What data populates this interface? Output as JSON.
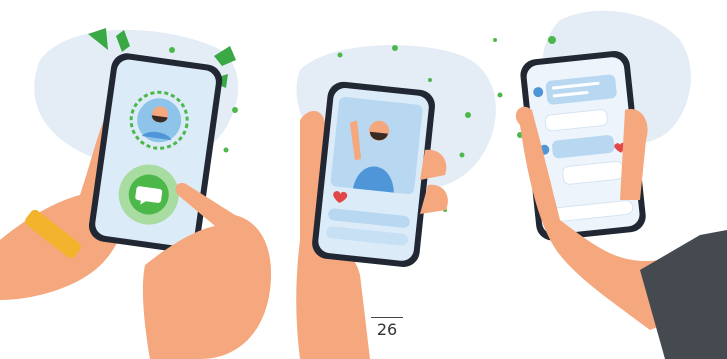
{
  "page": {
    "number": "26"
  },
  "colors": {
    "skin": "#f5a77e",
    "skin_shadow": "#e88e62",
    "blob": "#e4ecf6",
    "phone_frame": "#222833",
    "screen_bg": "#dcebf8",
    "green": "#4db84a",
    "light_green": "#a8dca0",
    "bubble_blue": "#b8d8f2",
    "heart": "#e24747",
    "watch": "#f4b32c",
    "sleeve": "#454a50",
    "avatar_shirt": "#4f96d8",
    "avatar_beard": "#3b2a22"
  },
  "icons": {
    "phone_left_chat": "chat-bubble-icon",
    "phone_center_like": "heart-icon",
    "phone_right_like": "heart-icon"
  }
}
